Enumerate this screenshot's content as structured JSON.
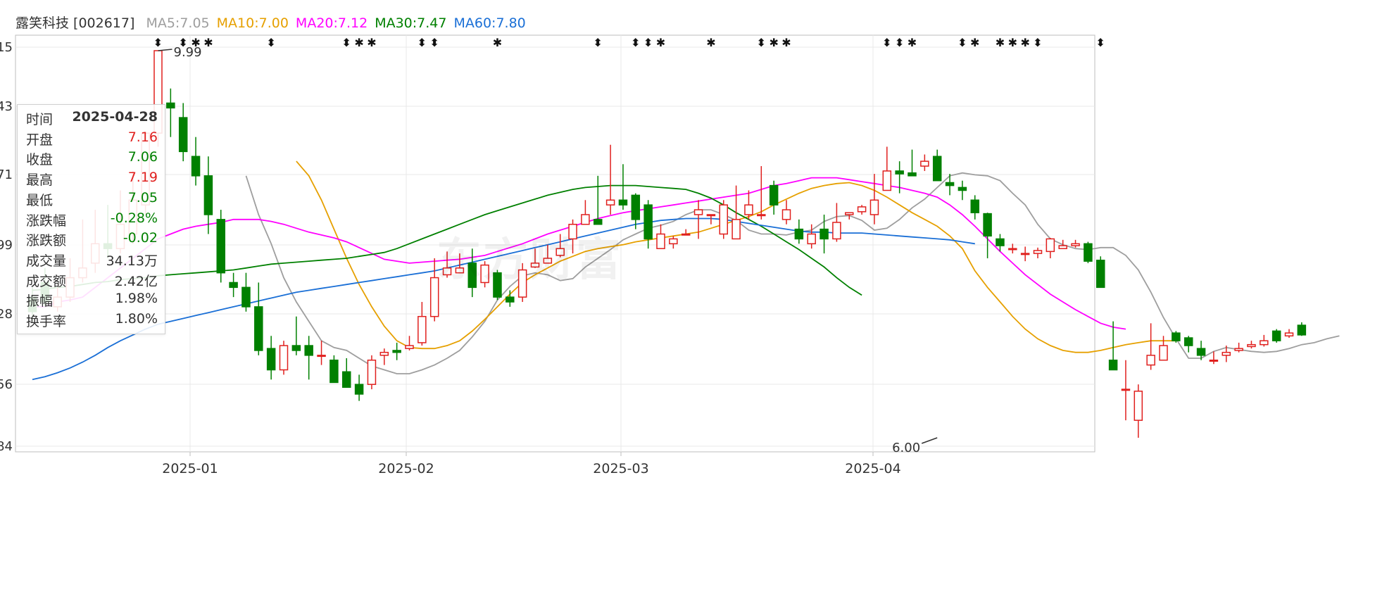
{
  "header": {
    "stock": "露笑科技 [002617]",
    "ma": [
      {
        "label": "MA5:7.05",
        "color": "#9e9e9e"
      },
      {
        "label": "MA10:7.00",
        "color": "#e6a000"
      },
      {
        "label": "MA20:7.12",
        "color": "#ff00ff"
      },
      {
        "label": "MA30:7.47",
        "color": "#008000"
      },
      {
        "label": "MA60:7.80",
        "color": "#1a6fd6"
      }
    ]
  },
  "tooltip": {
    "rows": [
      {
        "label": "时间",
        "value": "2025-04-28",
        "color": "#333333",
        "bold": true
      },
      {
        "label": "开盘",
        "value": "7.16",
        "color": "#e0201e"
      },
      {
        "label": "收盘",
        "value": "7.06",
        "color": "#008000"
      },
      {
        "label": "最高",
        "value": "7.19",
        "color": "#e0201e"
      },
      {
        "label": "最低",
        "value": "7.05",
        "color": "#008000"
      },
      {
        "label": "涨跌幅",
        "value": "-0.28%",
        "color": "#008000"
      },
      {
        "label": "涨跌额",
        "value": "-0.02",
        "color": "#008000"
      },
      {
        "label": "成交量",
        "value": "34.13万",
        "color": "#333333"
      },
      {
        "label": "成交额",
        "value": "2.42亿",
        "color": "#333333"
      },
      {
        "label": "振幅",
        "value": "1.98%",
        "color": "#333333"
      },
      {
        "label": "换手率",
        "value": "1.80%",
        "color": "#333333"
      }
    ]
  },
  "watermark": "东方财富",
  "chart_data": {
    "type": "candlestick",
    "ylim": [
      6.0,
      9.99
    ],
    "y_ticks": [
      "15",
      "43",
      "71",
      "99",
      "28",
      "56",
      "84"
    ],
    "x_ticks": [
      "2025-01",
      "2025-02",
      "2025-03",
      "2025-04"
    ],
    "max_label": "9.99",
    "min_label": "6.00",
    "colors": {
      "up": "#e0201e",
      "down": "#008000",
      "grid": "#e8e8e8"
    },
    "candles": [
      [
        7.45,
        7.3,
        7.55,
        7.2
      ],
      [
        7.6,
        7.4,
        7.75,
        7.35
      ],
      [
        7.35,
        7.45,
        7.55,
        7.3
      ],
      [
        7.45,
        7.65,
        7.85,
        7.4
      ],
      [
        7.65,
        7.75,
        8.25,
        7.6
      ],
      [
        7.8,
        8.0,
        8.35,
        7.7
      ],
      [
        8.0,
        7.95,
        8.4,
        7.85
      ],
      [
        7.95,
        8.2,
        8.55,
        7.9
      ],
      [
        8.1,
        8.45,
        8.75,
        8.0
      ],
      [
        8.4,
        9.14,
        9.14,
        8.3
      ],
      [
        9.14,
        9.99,
        9.99,
        9.0
      ],
      [
        9.45,
        9.4,
        9.6,
        9.1
      ],
      [
        9.3,
        8.95,
        9.45,
        8.85
      ],
      [
        8.9,
        8.7,
        9.1,
        8.6
      ],
      [
        8.7,
        8.3,
        8.9,
        8.1
      ],
      [
        8.25,
        7.7,
        8.35,
        7.6
      ],
      [
        7.6,
        7.55,
        7.7,
        7.45
      ],
      [
        7.55,
        7.35,
        7.7,
        7.3
      ],
      [
        7.35,
        6.9,
        7.6,
        6.85
      ],
      [
        6.92,
        6.7,
        7.05,
        6.6
      ],
      [
        6.7,
        6.95,
        7.0,
        6.65
      ],
      [
        6.95,
        6.9,
        7.25,
        6.85
      ],
      [
        6.95,
        6.85,
        7.05,
        6.6
      ],
      [
        6.85,
        6.85,
        7.0,
        6.75
      ],
      [
        6.8,
        6.57,
        6.85,
        6.57
      ],
      [
        6.68,
        6.52,
        6.82,
        6.52
      ],
      [
        6.55,
        6.45,
        6.65,
        6.38
      ],
      [
        6.55,
        6.8,
        6.85,
        6.5
      ],
      [
        6.85,
        6.88,
        6.92,
        6.75
      ],
      [
        6.9,
        6.88,
        6.98,
        6.8
      ],
      [
        6.92,
        6.95,
        7.05,
        6.9
      ],
      [
        6.98,
        7.25,
        7.4,
        6.95
      ],
      [
        7.25,
        7.65,
        7.85,
        7.2
      ],
      [
        7.68,
        7.75,
        7.92,
        7.65
      ],
      [
        7.7,
        7.75,
        7.9,
        7.7
      ],
      [
        7.8,
        7.55,
        7.95,
        7.45
      ],
      [
        7.6,
        7.78,
        7.82,
        7.55
      ],
      [
        7.7,
        7.45,
        7.73,
        7.42
      ],
      [
        7.45,
        7.4,
        7.52,
        7.35
      ],
      [
        7.45,
        7.73,
        7.8,
        7.4
      ],
      [
        7.76,
        7.8,
        7.95,
        7.75
      ],
      [
        7.8,
        7.85,
        7.99,
        7.82
      ],
      [
        7.88,
        7.95,
        8.1,
        7.86
      ],
      [
        8.05,
        8.2,
        8.25,
        7.9
      ],
      [
        8.2,
        8.3,
        8.45,
        8.2
      ],
      [
        8.25,
        8.2,
        8.7,
        8.2
      ],
      [
        8.4,
        8.45,
        9.02,
        8.3
      ],
      [
        8.45,
        8.4,
        8.82,
        8.35
      ],
      [
        8.5,
        8.25,
        8.52,
        8.15
      ],
      [
        8.4,
        8.05,
        8.45,
        7.95
      ],
      [
        7.95,
        8.1,
        8.2,
        7.95
      ],
      [
        8.0,
        8.05,
        8.08,
        7.95
      ],
      [
        8.1,
        8.1,
        8.15,
        8.1
      ],
      [
        8.3,
        8.35,
        8.45,
        8.05
      ],
      [
        8.3,
        8.3,
        8.3,
        8.2
      ],
      [
        8.1,
        8.4,
        8.45,
        8.05
      ],
      [
        8.05,
        8.25,
        8.6,
        8.05
      ],
      [
        8.3,
        8.4,
        8.55,
        8.25
      ],
      [
        8.3,
        8.3,
        8.8,
        8.25
      ],
      [
        8.6,
        8.4,
        8.65,
        8.3
      ],
      [
        8.25,
        8.35,
        8.45,
        8.2
      ],
      [
        8.15,
        8.05,
        8.25,
        8.0
      ],
      [
        8.0,
        8.1,
        8.2,
        7.95
      ],
      [
        8.15,
        8.05,
        8.3,
        7.9
      ],
      [
        8.05,
        8.22,
        8.42,
        8.02
      ],
      [
        8.3,
        8.32,
        8.3,
        8.25
      ],
      [
        8.33,
        8.38,
        8.4,
        8.3
      ],
      [
        8.3,
        8.45,
        8.72,
        8.2
      ],
      [
        8.55,
        8.75,
        9.0,
        8.55
      ],
      [
        8.75,
        8.72,
        8.85,
        8.52
      ],
      [
        8.73,
        8.7,
        8.97,
        8.72
      ],
      [
        8.8,
        8.85,
        8.92,
        8.75
      ],
      [
        8.9,
        8.65,
        8.97,
        8.65
      ],
      [
        8.63,
        8.6,
        8.72,
        8.5
      ],
      [
        8.58,
        8.55,
        8.65,
        8.45
      ],
      [
        8.45,
        8.32,
        8.5,
        8.25
      ],
      [
        8.31,
        8.08,
        8.32,
        7.85
      ],
      [
        8.05,
        7.98,
        8.1,
        7.92
      ],
      [
        7.95,
        7.95,
        8.0,
        7.9
      ],
      [
        7.9,
        7.9,
        7.97,
        7.82
      ],
      [
        7.9,
        7.93,
        7.96,
        7.85
      ],
      [
        7.92,
        8.05,
        8.06,
        7.85
      ],
      [
        7.95,
        7.98,
        8.04,
        7.95
      ],
      [
        7.98,
        8.0,
        8.04,
        7.96
      ],
      [
        8.0,
        7.82,
        8.02,
        7.8
      ],
      [
        7.83,
        7.55,
        7.87,
        7.55
      ],
      [
        6.8,
        6.7,
        7.2,
        6.7
      ],
      [
        6.5,
        6.5,
        6.8,
        6.18
      ],
      [
        6.18,
        6.48,
        6.55,
        6.0
      ],
      [
        6.75,
        6.85,
        7.18,
        6.7
      ],
      [
        6.8,
        6.95,
        7.05,
        6.8
      ],
      [
        7.08,
        7.0,
        7.1,
        6.98
      ],
      [
        7.03,
        6.95,
        7.05,
        6.88
      ],
      [
        6.92,
        6.85,
        7.0,
        6.8
      ],
      [
        6.8,
        6.8,
        6.89,
        6.76
      ],
      [
        6.85,
        6.88,
        6.95,
        6.78
      ],
      [
        6.9,
        6.92,
        6.98,
        6.88
      ],
      [
        6.94,
        6.96,
        7.0,
        6.92
      ],
      [
        6.96,
        7.0,
        7.06,
        6.94
      ],
      [
        7.1,
        7.0,
        7.12,
        6.98
      ],
      [
        7.05,
        7.08,
        7.12,
        7.03
      ],
      [
        7.16,
        7.06,
        7.19,
        7.05
      ]
    ],
    "series": [
      {
        "name": "MA5",
        "color": "#9e9e9e",
        "start": 17,
        "values": [
          8.7,
          8.3,
          8.0,
          7.65,
          7.4,
          7.2,
          7.0,
          6.93,
          6.9,
          6.82,
          6.74,
          6.7,
          6.66,
          6.66,
          6.7,
          6.75,
          6.82,
          6.9,
          7.04,
          7.2,
          7.42,
          7.56,
          7.67,
          7.7,
          7.68,
          7.62,
          7.64,
          7.76,
          7.85,
          7.94,
          8.04,
          8.1,
          8.16,
          8.19,
          8.23,
          8.3,
          8.35,
          8.35,
          8.3,
          8.24,
          8.14,
          8.1,
          8.1,
          8.09,
          8.12,
          8.14,
          8.23,
          8.28,
          8.29,
          8.24,
          8.14,
          8.16,
          8.25,
          8.37,
          8.46,
          8.58,
          8.7,
          8.73,
          8.71,
          8.7,
          8.65,
          8.52,
          8.4,
          8.2,
          8.05,
          7.99,
          7.95,
          7.94,
          7.96,
          7.96,
          7.88,
          7.73,
          7.5,
          7.24,
          7.02,
          6.82,
          6.82,
          6.89,
          6.93,
          6.91,
          6.89,
          6.88,
          6.89,
          6.92,
          6.96,
          6.98,
          7.02,
          7.05
        ]
      },
      {
        "name": "MA10",
        "color": "#e6a000",
        "start": 21,
        "values": [
          8.85,
          8.7,
          8.45,
          8.15,
          7.85,
          7.58,
          7.35,
          7.15,
          7.0,
          6.93,
          6.92,
          6.92,
          6.95,
          7.0,
          7.1,
          7.22,
          7.35,
          7.48,
          7.6,
          7.68,
          7.75,
          7.82,
          7.87,
          7.92,
          7.95,
          7.97,
          7.99,
          8.02,
          8.04,
          8.06,
          8.08,
          8.1,
          8.12,
          8.16,
          8.2,
          8.24,
          8.28,
          8.33,
          8.4,
          8.46,
          8.52,
          8.57,
          8.6,
          8.62,
          8.63,
          8.6,
          8.55,
          8.48,
          8.4,
          8.32,
          8.25,
          8.18,
          8.08,
          7.95,
          7.72,
          7.55,
          7.4,
          7.25,
          7.12,
          7.02,
          6.95,
          6.9,
          6.88,
          6.88,
          6.9,
          6.93,
          6.96,
          6.98,
          7.0,
          7.0,
          7.0
        ]
      },
      {
        "name": "MA20",
        "color": "#ff00ff",
        "start": 0,
        "values": [
          7.35,
          7.35,
          7.4,
          7.42,
          7.45,
          7.55,
          7.65,
          7.75,
          7.85,
          7.95,
          8.05,
          8.1,
          8.15,
          8.18,
          8.2,
          8.22,
          8.25,
          8.25,
          8.25,
          8.23,
          8.2,
          8.16,
          8.12,
          8.09,
          8.06,
          8.02,
          7.96,
          7.9,
          7.84,
          7.82,
          7.8,
          7.81,
          7.82,
          7.83,
          7.84,
          7.86,
          7.88,
          7.92,
          7.96,
          8.0,
          8.05,
          8.1,
          8.14,
          8.18,
          8.22,
          8.26,
          8.29,
          8.32,
          8.34,
          8.36,
          8.38,
          8.4,
          8.42,
          8.44,
          8.46,
          8.48,
          8.5,
          8.52,
          8.56,
          8.6,
          8.62,
          8.65,
          8.68,
          8.68,
          8.68,
          8.66,
          8.64,
          8.62,
          8.6,
          8.58,
          8.55,
          8.52,
          8.48,
          8.4,
          8.3,
          8.18,
          8.05,
          7.92,
          7.8,
          7.68,
          7.58,
          7.48,
          7.4,
          7.32,
          7.25,
          7.18,
          7.14,
          7.12
        ]
      },
      {
        "name": "MA30",
        "color": "#008000",
        "start": 0,
        "values": [
          7.52,
          7.53,
          7.55,
          7.56,
          7.58,
          7.6,
          7.61,
          7.63,
          7.64,
          7.65,
          7.67,
          7.68,
          7.69,
          7.7,
          7.71,
          7.72,
          7.73,
          7.75,
          7.77,
          7.79,
          7.8,
          7.81,
          7.82,
          7.83,
          7.84,
          7.85,
          7.87,
          7.89,
          7.91,
          7.95,
          8.0,
          8.05,
          8.1,
          8.15,
          8.2,
          8.25,
          8.3,
          8.34,
          8.38,
          8.42,
          8.46,
          8.5,
          8.53,
          8.56,
          8.58,
          8.59,
          8.6,
          8.6,
          8.6,
          8.59,
          8.58,
          8.57,
          8.56,
          8.52,
          8.47,
          8.4,
          8.32,
          8.25,
          8.18,
          8.1,
          8.02,
          7.94,
          7.85,
          7.76,
          7.65,
          7.55,
          7.47
        ]
      },
      {
        "name": "MA60",
        "color": "#1a6fd6",
        "start": 0,
        "values": [
          6.6,
          6.63,
          6.67,
          6.72,
          6.78,
          6.85,
          6.93,
          7.0,
          7.06,
          7.12,
          7.17,
          7.2,
          7.23,
          7.26,
          7.29,
          7.32,
          7.35,
          7.38,
          7.41,
          7.44,
          7.47,
          7.5,
          7.52,
          7.54,
          7.56,
          7.58,
          7.6,
          7.62,
          7.64,
          7.66,
          7.68,
          7.7,
          7.72,
          7.75,
          7.78,
          7.81,
          7.84,
          7.87,
          7.9,
          7.93,
          7.96,
          7.99,
          8.02,
          8.05,
          8.08,
          8.11,
          8.14,
          8.17,
          8.2,
          8.22,
          8.24,
          8.25,
          8.26,
          8.26,
          8.26,
          8.25,
          8.23,
          8.21,
          8.19,
          8.17,
          8.15,
          8.13,
          8.12,
          8.12,
          8.11,
          8.11,
          8.11,
          8.1,
          8.09,
          8.08,
          8.07,
          8.06,
          8.05,
          8.04,
          8.02,
          8.0
        ]
      }
    ],
    "markers": [
      {
        "i": 10,
        "sym": "⬍"
      },
      {
        "i": 12,
        "sym": "⬍"
      },
      {
        "i": 13,
        "sym": "✱"
      },
      {
        "i": 14,
        "sym": "✱"
      },
      {
        "i": 19,
        "sym": "⬍"
      },
      {
        "i": 25,
        "sym": "⬍"
      },
      {
        "i": 26,
        "sym": "✱"
      },
      {
        "i": 27,
        "sym": "✱"
      },
      {
        "i": 31,
        "sym": "⬍"
      },
      {
        "i": 32,
        "sym": "⬍"
      },
      {
        "i": 37,
        "sym": "✱"
      },
      {
        "i": 45,
        "sym": "⬍"
      },
      {
        "i": 48,
        "sym": "⬍"
      },
      {
        "i": 49,
        "sym": "⬍"
      },
      {
        "i": 50,
        "sym": "✱"
      },
      {
        "i": 54,
        "sym": "✱"
      },
      {
        "i": 58,
        "sym": "⬍"
      },
      {
        "i": 59,
        "sym": "✱"
      },
      {
        "i": 60,
        "sym": "✱"
      },
      {
        "i": 68,
        "sym": "⬍"
      },
      {
        "i": 69,
        "sym": "⬍"
      },
      {
        "i": 70,
        "sym": "✱"
      },
      {
        "i": 74,
        "sym": "⬍"
      },
      {
        "i": 75,
        "sym": "✱"
      },
      {
        "i": 77,
        "sym": "✱"
      },
      {
        "i": 78,
        "sym": "✱"
      },
      {
        "i": 79,
        "sym": "✱"
      },
      {
        "i": 80,
        "sym": "⬍"
      },
      {
        "i": 85,
        "sym": "⬍"
      }
    ]
  }
}
